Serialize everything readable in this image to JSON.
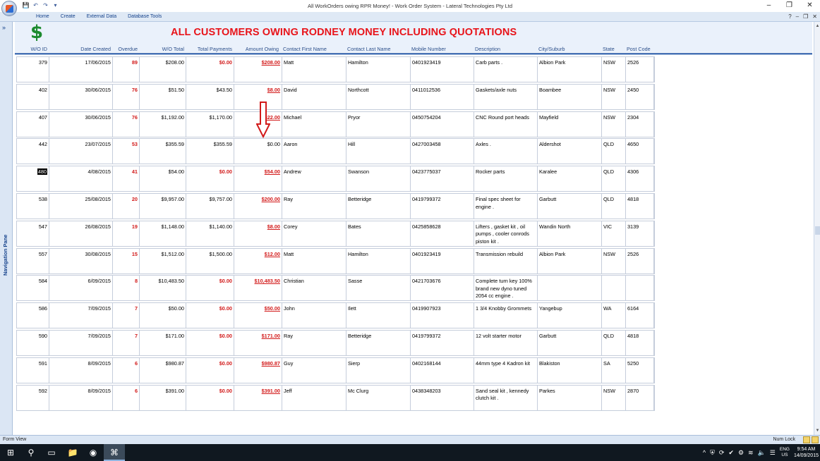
{
  "window": {
    "title": "All WorkOrders owing RPR Money! - Work Order System - Lateral Technologies Pty Ltd",
    "controls": [
      "–",
      "❐",
      "✕"
    ]
  },
  "qat": [
    "💾",
    "↶",
    "↷",
    "▾"
  ],
  "ribbon": {
    "tabs": [
      "Home",
      "Create",
      "External Data",
      "Database Tools"
    ],
    "controls": [
      "?",
      "–",
      "❐",
      "✕"
    ]
  },
  "nav": {
    "toggle": "»",
    "label": "Navigation Pane"
  },
  "report": {
    "icon_glyph": "$",
    "title": "ALL CUSTOMERS OWING RODNEY MONEY INCLUDING QUOTATIONS",
    "columns": [
      "W/O ID",
      "Date Created",
      "Overdue",
      "W/O Total",
      "Total Payments",
      "Amount Owing",
      "Contact First Name",
      "Contact Last Name",
      "Mobile Number",
      "Description",
      "City/Suburb",
      "State",
      "Post Code"
    ],
    "rows": [
      {
        "id": "379",
        "date": "17/06/2015",
        "overdue": "89",
        "total": "$208.00",
        "payments": "$0.00",
        "owing": "$208.00",
        "first": "Matt",
        "last": "Hamilton",
        "mobile": "0401923419",
        "desc": "Carb parts .",
        "city": "Albion Park",
        "state": "NSW",
        "post": "2526",
        "paid_red": true,
        "owing_red": true
      },
      {
        "id": "402",
        "date": "30/06/2015",
        "overdue": "76",
        "total": "$51.50",
        "payments": "$43.50",
        "owing": "$8.00",
        "first": "David",
        "last": "Northcott",
        "mobile": "0411012536",
        "desc": "Gaskets/axle nuts",
        "city": "Boambee",
        "state": "NSW",
        "post": "2450",
        "paid_red": false,
        "owing_red": true
      },
      {
        "id": "407",
        "date": "30/06/2015",
        "overdue": "76",
        "total": "$1,192.00",
        "payments": "$1,170.00",
        "owing": "$22.00",
        "first": "Michael",
        "last": "Pryor",
        "mobile": "0450754204",
        "desc": "CNC Round port heads",
        "city": "Mayfield",
        "state": "NSW",
        "post": "2304",
        "paid_red": false,
        "owing_red": true
      },
      {
        "id": "442",
        "date": "23/07/2015",
        "overdue": "53",
        "total": "$355.59",
        "payments": "$355.59",
        "owing": "$0.00",
        "first": "Aaron",
        "last": "Hill",
        "mobile": "0427003458",
        "desc": " Axles .",
        "city": "Aldershot",
        "state": "QLD",
        "post": "4650",
        "paid_red": false,
        "owing_red": false
      },
      {
        "id": "480",
        "date": "4/08/2015",
        "overdue": "41",
        "total": "$54.00",
        "payments": "$0.00",
        "owing": "$54.00",
        "first": "Andrew",
        "last": "Swanson",
        "mobile": "0423775037",
        "desc": "Rocker parts",
        "city": "Karalee",
        "state": "QLD",
        "post": "4306",
        "paid_red": true,
        "owing_red": true
      },
      {
        "id": "538",
        "date": "25/08/2015",
        "overdue": "20",
        "total": "$9,957.00",
        "payments": "$9,757.00",
        "owing": "$200.00",
        "first": "Ray",
        "last": "Betteridge",
        "mobile": "0419799372",
        "desc": "Final spec sheet for engine .",
        "city": "Garbutt",
        "state": "QLD",
        "post": "4818",
        "paid_red": false,
        "owing_red": true
      },
      {
        "id": "547",
        "date": "26/08/2015",
        "overdue": "19",
        "total": "$1,148.00",
        "payments": "$1,140.00",
        "owing": "$8.00",
        "first": "Corey",
        "last": "Bates",
        "mobile": "0425858628",
        "desc": "Lifters , gasket kit , oil pumps , cooler conrods piston kit .",
        "city": "Wandin North",
        "state": "VIC",
        "post": "3139",
        "paid_red": false,
        "owing_red": true
      },
      {
        "id": "557",
        "date": "30/08/2015",
        "overdue": "15",
        "total": "$1,512.00",
        "payments": "$1,500.00",
        "owing": "$12.00",
        "first": "Matt",
        "last": "Hamilton",
        "mobile": "0401923419",
        "desc": "Transmission rebuild",
        "city": "Albion Park",
        "state": "NSW",
        "post": "2526",
        "paid_red": false,
        "owing_red": true
      },
      {
        "id": "584",
        "date": "6/09/2015",
        "overdue": "8",
        "total": "$10,483.50",
        "payments": "$0.00",
        "owing": "$10,483.50",
        "first": "Christian",
        "last": "Sasse",
        "mobile": "0421703676",
        "desc": "Complete turn key 100% brand new dyno tuned 2054 cc engine .",
        "city": "",
        "state": "",
        "post": "",
        "paid_red": true,
        "owing_red": true
      },
      {
        "id": "586",
        "date": "7/09/2015",
        "overdue": "7",
        "total": "$50.00",
        "payments": "$0.00",
        "owing": "$50.00",
        "first": "John",
        "last": "Ilett",
        "mobile": "0419907923",
        "desc": "1 3/4 Knobby Grommets",
        "city": " Yangebup",
        "state": "WA",
        "post": "6164",
        "paid_red": true,
        "owing_red": true
      },
      {
        "id": "590",
        "date": "7/09/2015",
        "overdue": "7",
        "total": "$171.00",
        "payments": "$0.00",
        "owing": "$171.00",
        "first": "Ray",
        "last": "Betteridge",
        "mobile": "0419799372",
        "desc": "12 volt starter motor",
        "city": "Garbutt",
        "state": "QLD",
        "post": "4818",
        "paid_red": true,
        "owing_red": true
      },
      {
        "id": "591",
        "date": "8/09/2015",
        "overdue": "6",
        "total": "$980.87",
        "payments": "$0.00",
        "owing": "$980.87",
        "first": "Guy",
        "last": "Sierp",
        "mobile": "0402168144",
        "desc": "44mm type 4 Kadron kit",
        "city": "Blakiston",
        "state": "SA",
        "post": "5250",
        "paid_red": true,
        "owing_red": true
      },
      {
        "id": "592",
        "date": "8/09/2015",
        "overdue": "6",
        "total": "$391.00",
        "payments": "$0.00",
        "owing": "$391.00",
        "first": "Jeff",
        "last": "Mc Clurg",
        "mobile": "0438348203",
        "desc": "Sand seal kit , kennedy clutch kit .",
        "city": "Parkes",
        "state": "NSW",
        "post": "2870",
        "paid_red": true,
        "owing_red": true
      }
    ],
    "selected_row_index": 4
  },
  "status": {
    "view": "Form View",
    "numlock": "Num Lock"
  },
  "taskbar": {
    "clock_time": "9:54 AM",
    "clock_date": "14/09/2015",
    "lang_top": "ENG",
    "lang_bottom": "US",
    "tray": [
      "^",
      "⛨",
      "⟳",
      "✔",
      "⚙",
      "≋",
      "🔈",
      "☰"
    ],
    "apps": [
      "⊞",
      "⚲",
      "▭",
      "📁",
      "◉",
      "⌘"
    ]
  },
  "colors": {
    "accent_red": "#d21a1a",
    "title_red": "#e8141a",
    "dollar_green": "#1c8a2e",
    "header_blue": "#2c4f8a"
  }
}
